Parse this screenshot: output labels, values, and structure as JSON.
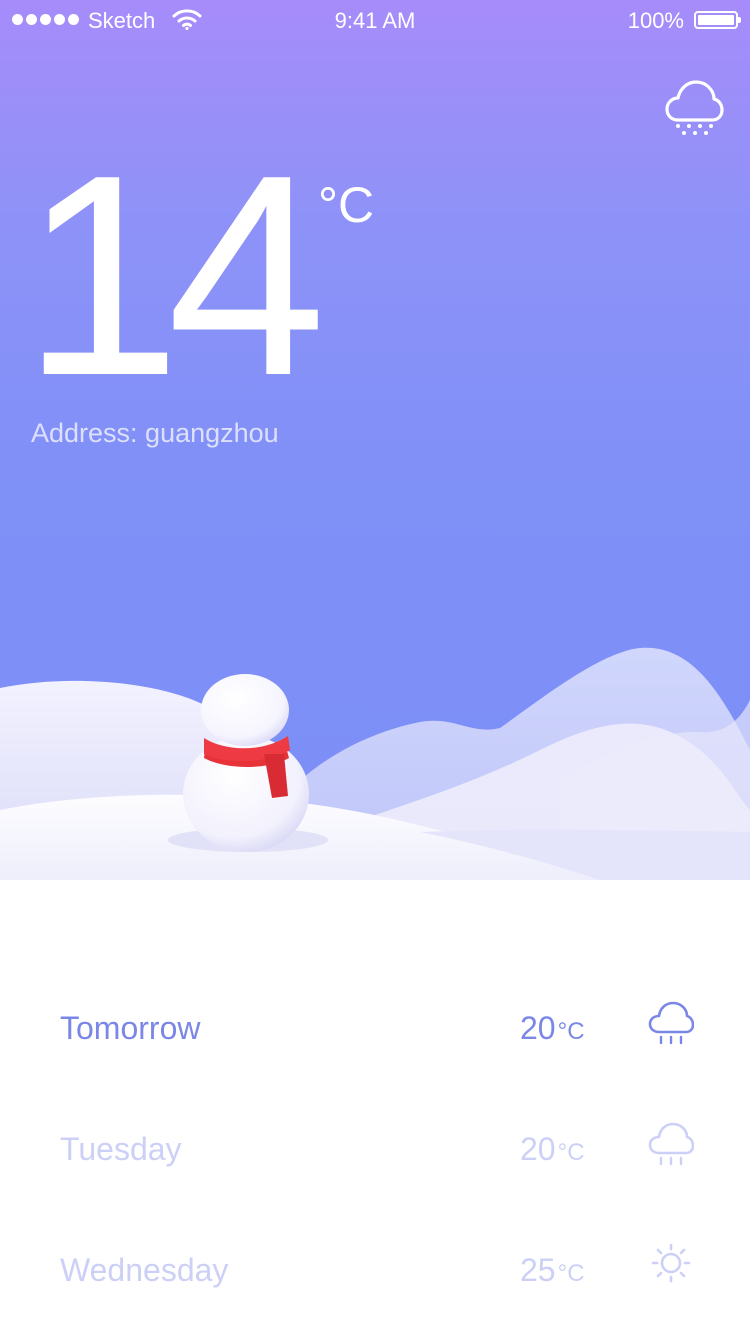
{
  "status_bar": {
    "carrier": "Sketch",
    "time": "9:41 AM",
    "battery": "100%",
    "icons": [
      "signal-dots-icon",
      "wifi-icon",
      "battery-icon"
    ]
  },
  "current": {
    "temperature": "14",
    "unit": "°C",
    "address": "Address: guangzhou",
    "icon": "snow-cloud-icon"
  },
  "forecast": [
    {
      "day": "Tomorrow",
      "temp": "20",
      "unit": "°C",
      "icon": "rain-cloud-icon"
    },
    {
      "day": "Tuesday",
      "temp": "20",
      "unit": "°C",
      "icon": "rain-cloud-icon"
    },
    {
      "day": "Wednesday",
      "temp": "25",
      "unit": "°C",
      "icon": "sun-icon"
    }
  ],
  "colors": {
    "gradient_top": "#a68cfa",
    "gradient_bottom": "#7c8ff7",
    "accent": "#7b87e6",
    "muted": "#ccd0f6",
    "scarf": "#e8323a"
  }
}
